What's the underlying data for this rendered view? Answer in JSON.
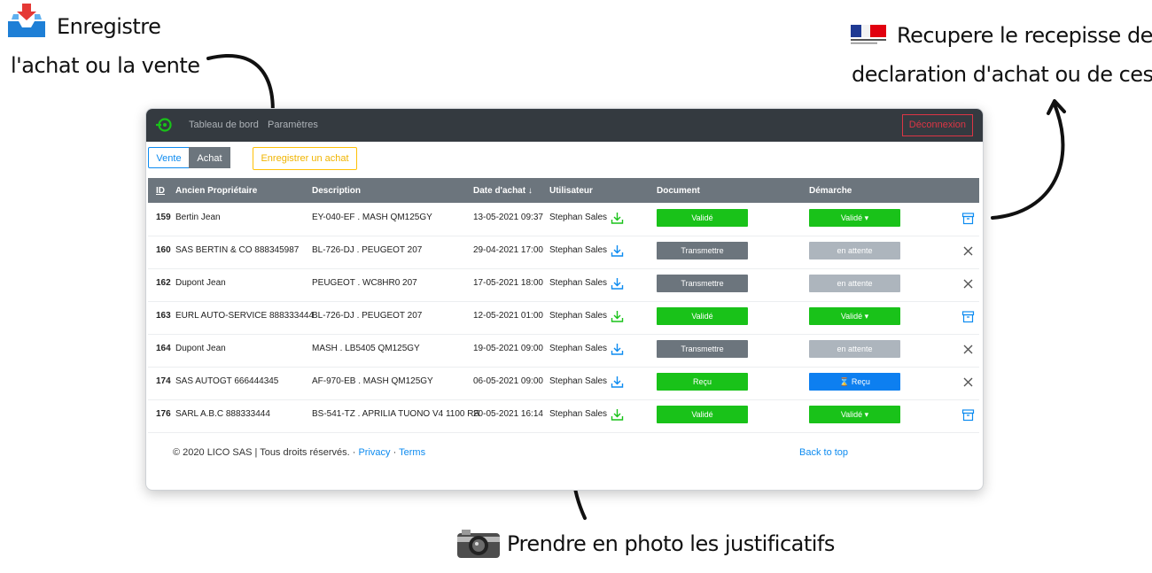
{
  "annotations": {
    "register": {
      "line1": "Enregistre",
      "line2": "l'achat ou la vente"
    },
    "recepisse": {
      "line1": "Recupere le recepisse de",
      "line2": "declaration d'achat ou de cession"
    },
    "photo": {
      "text": "Prendre en photo les justificatifs"
    }
  },
  "app": {
    "nav": {
      "dashboard": "Tableau de bord",
      "settings": "Paramètres"
    },
    "logout_label": "Déconnexion",
    "toggle": {
      "vente": "Vente",
      "achat": "Achat"
    },
    "register_button": "Enregistrer un achat",
    "columns": {
      "id": "ID",
      "owner": "Ancien Propriétaire",
      "description": "Description",
      "date": "Date d'achat ↓",
      "user": "Utilisateur",
      "document": "Document",
      "procedure": "Démarche"
    },
    "rows": [
      {
        "id": "159",
        "owner": "Bertin Jean",
        "description": "EY-040-EF . MASH QM125GY",
        "date": "13-05-2021 09:37",
        "user": "Stephan Sales",
        "document": "Validé",
        "procedure": "Validé ▾"
      },
      {
        "id": "160",
        "owner": "SAS BERTIN & CO 888345987",
        "description": "BL-726-DJ . PEUGEOT 207",
        "date": "29-04-2021 17:00",
        "user": "Stephan Sales",
        "document": "Transmettre",
        "procedure": "en attente"
      },
      {
        "id": "162",
        "owner": "Dupont Jean",
        "description": "PEUGEOT . WC8HR0 207",
        "date": "17-05-2021 18:00",
        "user": "Stephan Sales",
        "document": "Transmettre",
        "procedure": "en attente"
      },
      {
        "id": "163",
        "owner": "EURL AUTO-SERVICE 888333444",
        "description": "BL-726-DJ . PEUGEOT 207",
        "date": "12-05-2021 01:00",
        "user": "Stephan Sales",
        "document": "Validé",
        "procedure": "Validé ▾"
      },
      {
        "id": "164",
        "owner": "Dupont Jean",
        "description": "MASH . LB5405 QM125GY",
        "date": "19-05-2021 09:00",
        "user": "Stephan Sales",
        "document": "Transmettre",
        "procedure": "en attente"
      },
      {
        "id": "174",
        "owner": "SAS AUTOGT 666444345",
        "description": "AF-970-EB . MASH QM125GY",
        "date": "06-05-2021 09:00",
        "user": "Stephan Sales",
        "document": "Reçu",
        "procedure": "⌛ Reçu"
      },
      {
        "id": "176",
        "owner": "SARL A.B.C 888333444",
        "description": "BS-541-TZ . APRILIA TUONO V4 1100 RR",
        "date": "20-05-2021 16:14",
        "user": "Stephan Sales",
        "document": "Validé",
        "procedure": "Validé ▾"
      }
    ],
    "footer": {
      "copyright": "© 2020 LICO SAS | Tous droits réservés. ·",
      "privacy": "Privacy",
      "sep": "·",
      "terms": "Terms",
      "back_to_top": "Back to top"
    }
  },
  "colors": {
    "green": "#19c219",
    "grey": "#6c757d",
    "lightgrey": "#adb5bd",
    "blue": "#0d7ff0",
    "danger": "#dc3545",
    "warning": "#ffc107"
  }
}
